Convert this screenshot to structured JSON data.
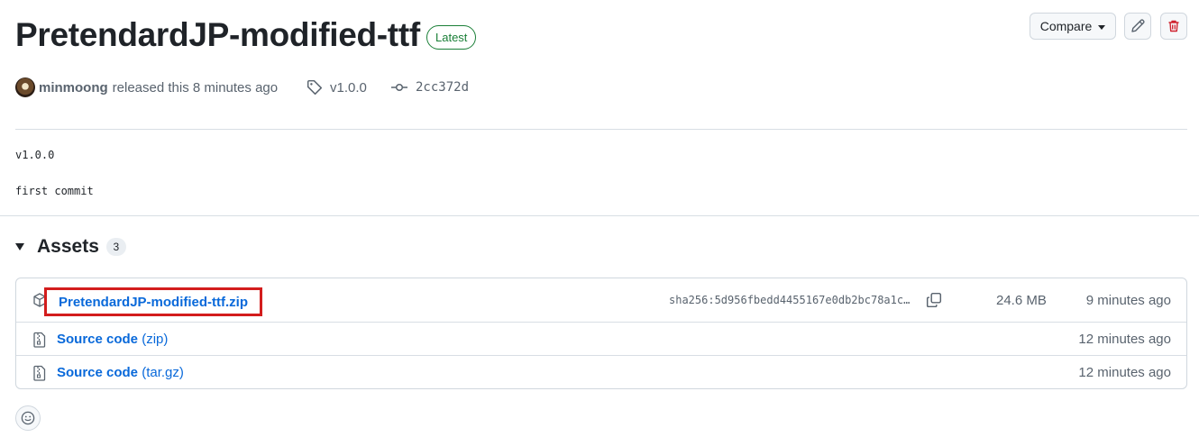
{
  "release": {
    "title": "PretendardJP-modified-ttf",
    "badge": "Latest",
    "author": "minmoong",
    "released_text": "released this 8 minutes ago",
    "tag": "v1.0.0",
    "commit": "2cc372d",
    "body_lines": [
      "v1.0.0",
      "first commit"
    ]
  },
  "toolbar": {
    "compare_label": "Compare",
    "edit_icon": "pencil-icon",
    "delete_icon": "trash-icon"
  },
  "assets": {
    "title": "Assets",
    "count": "3",
    "items": [
      {
        "name": "PretendardJP-modified-ttf.zip",
        "sha": "sha256:5d956fbedd4455167e0db2bc78a1c…",
        "size": "24.6 MB",
        "time": "9 minutes ago",
        "icon": "package-icon"
      },
      {
        "name": "Source code",
        "suffix": "(zip)",
        "time": "12 minutes ago",
        "icon": "file-zip-icon"
      },
      {
        "name": "Source code",
        "suffix": "(tar.gz)",
        "time": "12 minutes ago",
        "icon": "file-zip-icon"
      }
    ]
  },
  "colors": {
    "link": "#0969da",
    "latest_green": "#1a7f37",
    "highlight_red": "#d31d1d",
    "delete_red": "#cf222e"
  }
}
